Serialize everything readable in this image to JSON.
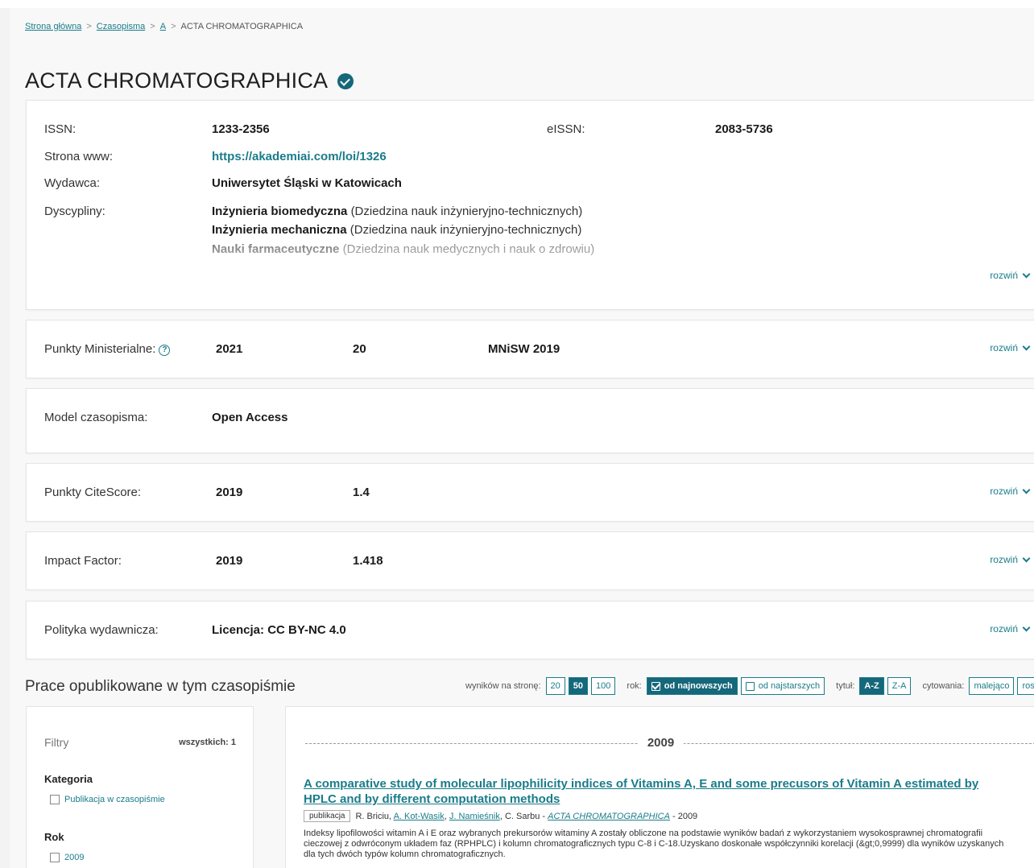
{
  "breadcrumb": {
    "home": "Strona główna",
    "journals": "Czasopisma",
    "letter": "A",
    "current": "ACTA CHROMATOGRAPHICA",
    "separator": ">"
  },
  "title": "ACTA CHROMATOGRAPHICA",
  "info": {
    "issn_label": "ISSN:",
    "issn_value": "1233-2356",
    "eissn_label": "eISSN:",
    "eissn_value": "2083-5736",
    "www_label": "Strona www:",
    "www_value": "https://akademiai.com/loi/1326",
    "publisher_label": "Wydawca:",
    "publisher_value": "Uniwersytet Śląski w Katowicach",
    "disciplines_label": "Dyscypliny:",
    "disciplines": [
      {
        "name": "Inżynieria biomedyczna",
        "domain": "(Dziedzina nauk inżynieryjno-technicznych)"
      },
      {
        "name": "Inżynieria mechaniczna",
        "domain": "(Dziedzina nauk inżynieryjno-technicznych)"
      },
      {
        "name": "Nauki farmaceutyczne",
        "domain": "(Dziedzina nauk medycznych i nauk o zdrowiu)"
      }
    ],
    "expand": "rozwiń"
  },
  "ministry": {
    "label": "Punkty Ministerialne:",
    "help_icon": "?",
    "year": "2021",
    "points": "20",
    "source": "MNiSW 2019",
    "expand": "rozwiń"
  },
  "model": {
    "label": "Model czasopisma:",
    "value": "Open Access"
  },
  "citescore": {
    "label": "Punkty CiteScore:",
    "year": "2019",
    "value": "1.4",
    "expand": "rozwiń"
  },
  "impact": {
    "label": "Impact Factor:",
    "year": "2019",
    "value": "1.418",
    "expand": "rozwiń"
  },
  "policy": {
    "label": "Polityka wydawnicza:",
    "value": "Licencja: CC BY-NC 4.0",
    "expand": "rozwiń"
  },
  "publications": {
    "title": "Prace opublikowane w tym czasopiśmie",
    "controls": {
      "per_page_label": "wyników na stronę:",
      "per_page_options": [
        "20",
        "50",
        "100"
      ],
      "year_label": "rok:",
      "year_newest": "od najnowszych",
      "year_oldest": "od najstarszych",
      "title_label": "tytuł:",
      "title_az": "A-Z",
      "title_za": "Z-A",
      "citations_label": "cytowania:",
      "citations_desc": "malejąco",
      "citations_asc": "rosnąco"
    },
    "filters": {
      "title": "Filtry",
      "count": "wszystkich: 1",
      "category_head": "Kategoria",
      "category_item": "Publikacja w czasopiśmie",
      "year_head": "Rok",
      "year_item": "2009"
    },
    "results": {
      "year": "2009",
      "item": {
        "title": "A comparative study of molecular lipophilicity indices of Vitamins A, E and some precusors of Vitamin A estimated by HPLC and by different computation methods",
        "badge": "publikacja",
        "author1": "R. Briciu,",
        "author2": "A. Kot-Wasik",
        "author_sep": ",",
        "author3": "J. Namieśnik",
        "author4": ", C. Sarbu -",
        "journal": "ACTA CHROMATOGRAPHICA",
        "year_suffix": "- 2009",
        "abstract": "Indeksy lipofilowości witamin A i E oraz wybranych prekursorów witaminy A zostały obliczone na podstawie wyników badań z wykorzystaniem wysokosprawnej chromatografii cieczowej z odwróconym układem faz (RPHPLC) i kolumn chromatograficznych typu C-8 i C-18.Uzyskano doskonałe współczynniki korelacji (&gt;0,9999) dla wyników uzyskanych dla tych dwóch typów kolumn chromatograficznych."
      }
    }
  }
}
